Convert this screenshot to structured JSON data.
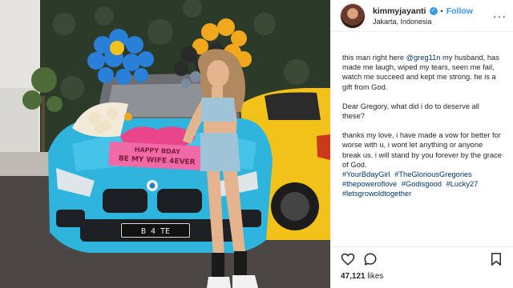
{
  "post": {
    "username": "kimmyjayanti",
    "verified_badge": "✓",
    "separator": "•",
    "follow_label": "Follow",
    "location": "Jakarta, Indonesia",
    "more_icon": "more-options-icon",
    "more_label": "···"
  },
  "caption": {
    "p1_before": "this man right here ",
    "p1_mention": "@greg11n",
    "p1_after": " my husband, has made me laugh, wiped my tears, seen me fail, watch me succeed and kept me strong. he is a gift from God.",
    "p2": "Dear Gregory, what did i do to deserve all these?",
    "p3": "thanks my love, i have made a vow for better for worse with u, i wont let anything or anyone break us. i will stand by you forever by the grace of God.",
    "hashtags": [
      "#YourBdayGirl",
      "#TheGloriousGregories",
      "#thepoweroflove",
      "#Godisgood",
      "#Lucky27",
      "#letsgrowoldtogether"
    ]
  },
  "photo": {
    "sign_line1": "HAPPY BDAY",
    "sign_line2": "BE MY WIFE 4EVER",
    "plate": "B 4     TE",
    "colors": {
      "car": "#2fb4de",
      "yellow_car": "#f2c21a",
      "hedge": "#2c3a2a",
      "balloon_blue": "#2a80d8",
      "balloon_orange": "#f2a81c",
      "heart_cake": "#e8458c"
    }
  },
  "actions": {
    "like_icon": "heart-icon",
    "comment_icon": "comment-icon",
    "save_icon": "bookmark-icon"
  },
  "likes": {
    "count": "47,121",
    "label": " likes"
  }
}
